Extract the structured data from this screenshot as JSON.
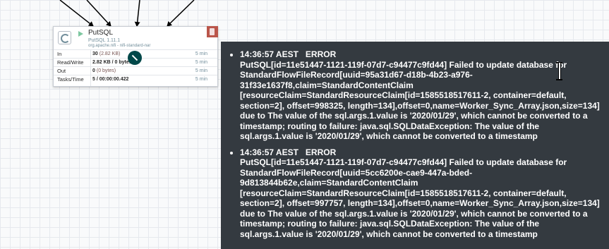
{
  "processor": {
    "name": "PutSQL",
    "type": "PutSQL 1.11.1",
    "bundle": "org.apache.nifi - nifi-standard-nar",
    "stats": [
      {
        "label": "In",
        "value": "30",
        "sub": "(2.82 KB)",
        "time": "5 min"
      },
      {
        "label": "Read/Write",
        "value": "2.82 KB / 0 bytes",
        "sub": "",
        "time": "5 min"
      },
      {
        "label": "Out",
        "value": "0",
        "sub": "(0 bytes)",
        "time": "5 min"
      },
      {
        "label": "Tasks/Time",
        "value": "5 / 00:00:00.422",
        "sub": "",
        "time": "5 min"
      }
    ]
  },
  "bulletins": [
    {
      "header": "14:36:57 AEST   ERROR",
      "message": "PutSQL[id=11e51447-1121-119f-07d7-c94477c9fd44] Failed to update database for StandardFlowFileRecord[uuid=95a31d67-d18b-4b23-a976-31f33e1637f8,claim=StandardContentClaim [resourceClaim=StandardResourceClaim[id=1585518517611-2, container=default, section=2], offset=998325, length=134],offset=0,name=Worker_Sync_Array.json,size=134] due to The value of the sql.args.1.value is '2020/01/29', which cannot be converted to a timestamp; routing to failure: java.sql.SQLDataException: The value of the sql.args.1.value is '2020/01/29', which cannot be converted to a timestamp"
    },
    {
      "header": "14:36:57 AEST   ERROR",
      "message": "PutSQL[id=11e51447-1121-119f-07d7-c94477c9fd44] Failed to update database for StandardFlowFileRecord[uuid=5cc6200e-cae9-447a-bded-9d813844b62e,claim=StandardContentClaim [resourceClaim=StandardResourceClaim[id=1585518517611-2, container=default, section=2], offset=997757, length=134],offset=0,name=Worker_Sync_Array.json,size=134] due to The value of the sql.args.1.value is '2020/01/29', which cannot be converted to a timestamp; routing to failure: java.sql.SQLDataException: The value of the sql.args.1.value is '2020/01/29', which cannot be converted to a timestamp"
    }
  ],
  "colors": {
    "bulletin_error": "#ba554a",
    "tooltip_bg": "#343a40",
    "canvas_bg": "#f9fafb"
  }
}
